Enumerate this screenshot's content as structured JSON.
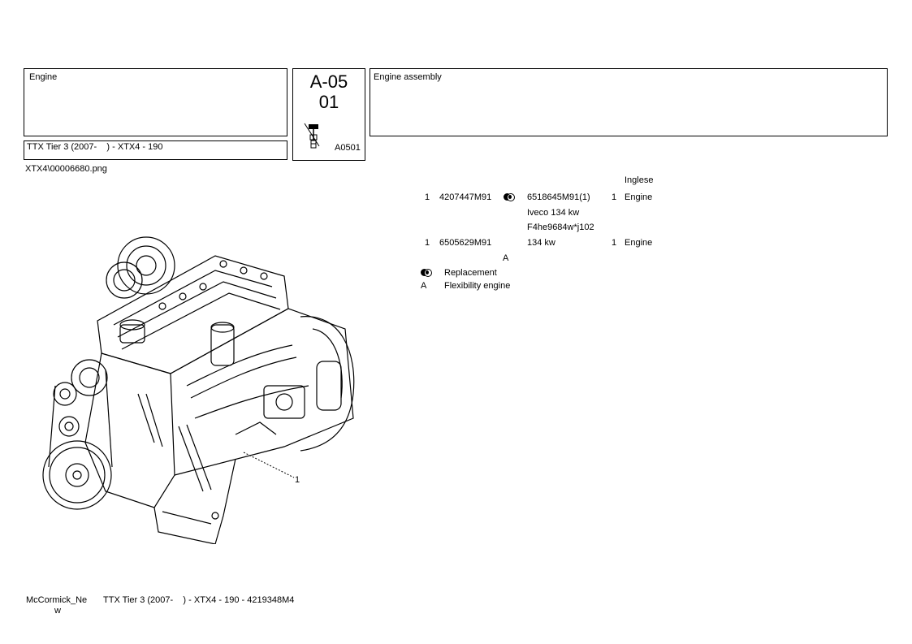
{
  "header": {
    "group_title": "Engine",
    "model_line": "TTX Tier 3 (2007-    ) - XTX4 - 190",
    "code_top": "A-05",
    "code_bottom": "01",
    "ref_code": "A0501",
    "description": "Engine assembly"
  },
  "image_filename": "XTX4\\00006680.png",
  "parts_table": {
    "language_header": "Inglese",
    "rows": [
      {
        "pos": "1",
        "part": "4207447M91",
        "replacement": "6518645M91(1)",
        "qty": "1",
        "desc": "Engine",
        "notes": [
          "Iveco 134 kw",
          "F4he9684w*j102"
        ]
      },
      {
        "pos": "1",
        "part": "6505629M91",
        "replacement": "134 kw",
        "qty": "1",
        "desc": "Engine",
        "flag": "A"
      }
    ]
  },
  "legend": [
    {
      "symbol": "replacement-icon",
      "label": "Replacement"
    },
    {
      "symbol": "A",
      "label": "Flexibility engine"
    }
  ],
  "callout_label": "1",
  "footer": {
    "brand_line1": "McCormick_Ne",
    "brand_line2": "w",
    "model_line": "TTX Tier 3 (2007-    ) - XTX4 - 190 - 4219348M4"
  }
}
